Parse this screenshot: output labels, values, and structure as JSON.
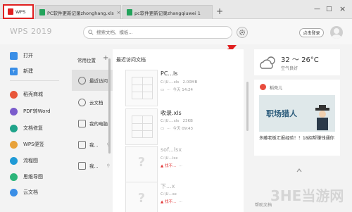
{
  "tabs": [
    {
      "label": "WPS"
    },
    {
      "label": "PC软件更新记录zhonghang.xls",
      "color": "#22a35b"
    },
    {
      "label": "pc软件更新记录zhangqiuwei 1",
      "color": "#22a35b"
    }
  ],
  "new_tab_symbol": "+",
  "window_controls": {
    "minimize": "—",
    "restore": "□",
    "close": "×"
  },
  "header": {
    "brand": "WPS 2019",
    "search_placeholder": "搜索文档、模板...",
    "login_label": "点击登录"
  },
  "sidebar": {
    "items": [
      {
        "label": "打开",
        "icon": "folder-icon",
        "color": "#3a8ee6"
      },
      {
        "label": "新建",
        "icon": "plus-icon",
        "color": "#3a8ee6"
      },
      {
        "label": "稻壳商城",
        "icon": "shop-icon",
        "color": "#e8563a"
      },
      {
        "label": "PDF转Word",
        "icon": "pdf-icon",
        "color": "#7a5ccc"
      },
      {
        "label": "文档修复",
        "icon": "repair-icon",
        "color": "#1fa38a"
      },
      {
        "label": "WPS便签",
        "icon": "note-icon",
        "color": "#e8a23a"
      },
      {
        "label": "流程图",
        "icon": "flowchart-icon",
        "color": "#1f9ad6"
      },
      {
        "label": "思维导图",
        "icon": "mindmap-icon",
        "color": "#2cb57a"
      },
      {
        "label": "云文档",
        "icon": "cloud-icon",
        "color": "#3a8ee6"
      }
    ]
  },
  "midnav": {
    "header": "常用位置",
    "add": "+",
    "items": [
      {
        "label": "最近访问"
      },
      {
        "label": "云文档"
      },
      {
        "label": "我的电脑"
      },
      {
        "label": "我..."
      },
      {
        "label": "我..."
      }
    ]
  },
  "recent": {
    "title": "最近访问文档",
    "docs": [
      {
        "name": "PC...ls",
        "path": "C:\\U....xls",
        "size": "2.00MB",
        "time": "今天 14:24",
        "status": ""
      },
      {
        "name": "收录.xls",
        "path": "C:\\U....xls",
        "size": "23KB",
        "time": "今天 09:43",
        "status": ""
      },
      {
        "name": "sof...lsx",
        "path": "C:\\U...lsx",
        "size": "",
        "time": "",
        "status": "找不..."
      },
      {
        "name": "下...x",
        "path": "C:\\U...sx",
        "size": "",
        "time": "",
        "status": "找不..."
      }
    ]
  },
  "weather": {
    "temp": "32 ～ 26°C",
    "air": "空气良好"
  },
  "news": {
    "source": "稻壳儿",
    "banner": "职场猎人",
    "headline": "多藤老板汇报经验！！18招帮赚钱通你"
  },
  "statusbar": "帮助文档",
  "watermark": "3HE当游网"
}
